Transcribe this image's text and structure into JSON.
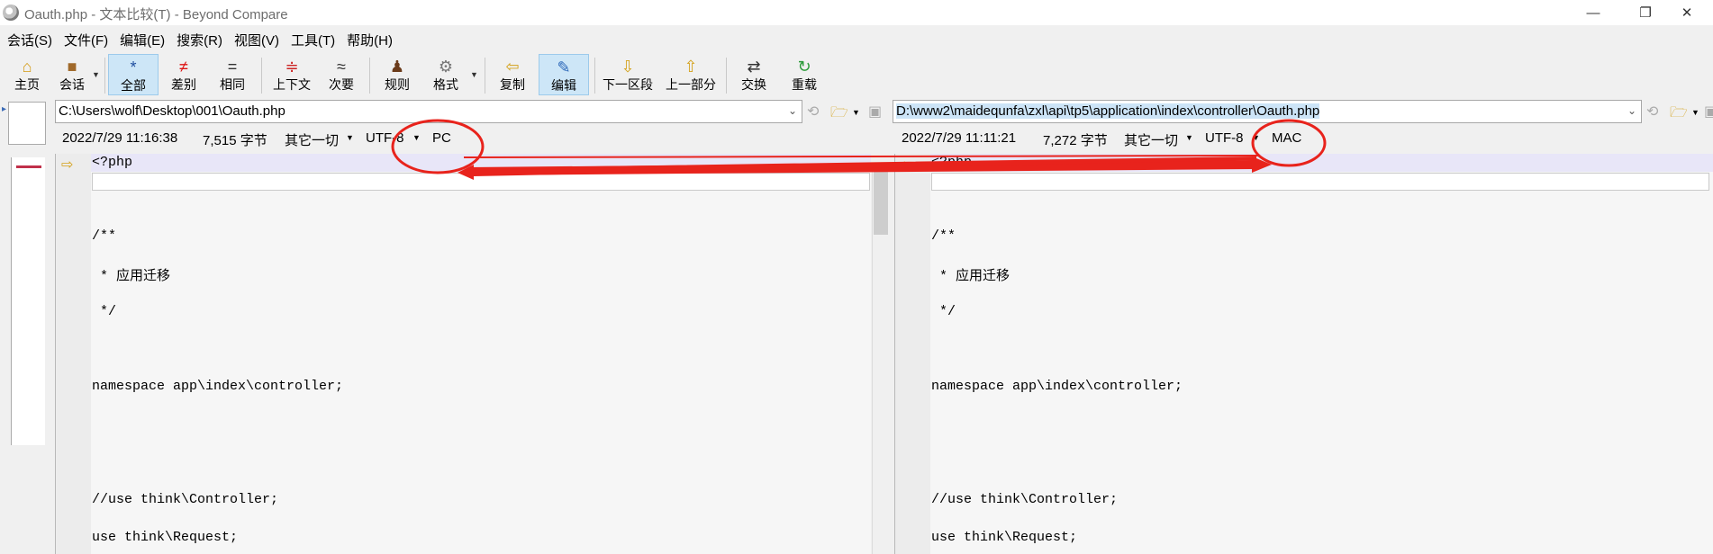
{
  "window": {
    "title": "Oauth.php - 文本比较(T) - Beyond Compare",
    "minimize": "—",
    "restore": "❐",
    "close": "✕"
  },
  "menu": [
    "会话(S)",
    "文件(F)",
    "编辑(E)",
    "搜索(R)",
    "视图(V)",
    "工具(T)",
    "帮助(H)"
  ],
  "toolbar": {
    "home": "主页",
    "session": "会话",
    "all": "全部",
    "diffs": "差别",
    "same": "相同",
    "context": "上下文",
    "minor": "次要",
    "rules": "规则",
    "format": "格式",
    "copy": "复制",
    "edit": "编辑",
    "next_section": "下一区段",
    "prev_section": "上一部分",
    "swap": "交换",
    "reload": "重载"
  },
  "left": {
    "path": "C:\\Users\\wolf\\Desktop\\001\\Oauth.php",
    "timestamp": "2022/7/29 11:16:38",
    "size": "7,515 字节",
    "other": "其它一切",
    "encoding": "UTF-8",
    "line_ending": "PC"
  },
  "right": {
    "path": "D:\\www2\\maidequnfa\\zxl\\api\\tp5\\application\\index\\controller\\Oauth.php",
    "timestamp": "2022/7/29 11:11:21",
    "size": "7,272 字节",
    "other": "其它一切",
    "encoding": "UTF-8",
    "line_ending": "MAC"
  },
  "code": {
    "php_open": "<?php",
    "doc_open": "/**",
    "doc_line": " * 应用迁移",
    "doc_close": " */",
    "namespace": "namespace app\\index\\controller;",
    "use_controller": "//use think\\Controller;",
    "use_request": "use think\\Request;"
  },
  "colors": {
    "annotation_red": "#e8231c",
    "active_button_bg": "#cde6f7",
    "selected_path_bg": "#cce4f7"
  }
}
